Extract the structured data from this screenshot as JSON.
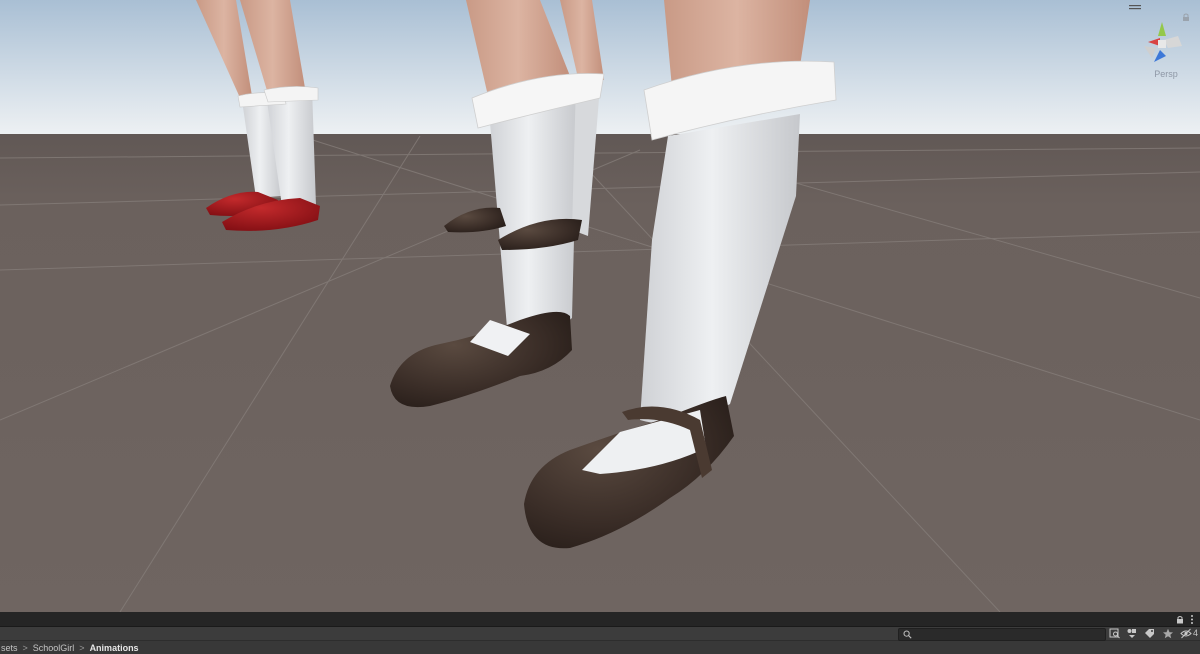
{
  "scene": {
    "view_mode_label": "Persp",
    "colors": {
      "sky_top": "#a9bfd4",
      "sky_horizon": "#eef1f3",
      "ground": "#6e6460",
      "grid_line": "#8a8380",
      "sock_white": "#e7e8ea",
      "shoe_brown": "#3b2f29",
      "shoe_red": "#a3161b",
      "skin": "#d3a995"
    }
  },
  "project_panel": {
    "search": {
      "value": "",
      "placeholder": ""
    },
    "hidden_count": "4",
    "breadcrumb": [
      {
        "label": "sets",
        "current": false
      },
      {
        "label": "SchoolGirl",
        "current": false
      },
      {
        "label": "Animations",
        "current": true
      }
    ],
    "breadcrumb_separator": ">"
  }
}
